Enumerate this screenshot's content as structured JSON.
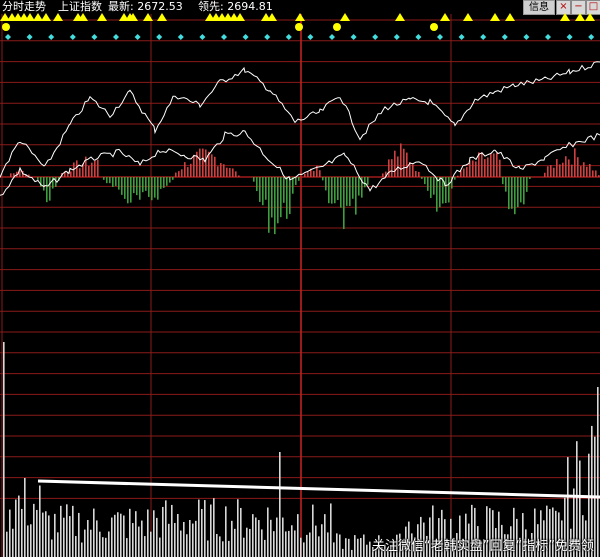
{
  "header": {
    "title": "分时走势",
    "index_name": "上证指数",
    "latest": "最新: 2672.53",
    "leading": "领先: 2694.81",
    "info_button": "信息",
    "close_glyph": "×",
    "minimize_glyph": "−",
    "restore_glyph": "□"
  },
  "colors": {
    "background": "#000000",
    "grid": "#8b1a1a",
    "grid_major": "#c02020",
    "price_line": "#ffffff",
    "up_bar": "#d04040",
    "down_bar": "#3f9e3f",
    "volume_bar": "#d8d8d8",
    "signal_triangle": "#ffff00",
    "signal_diamond": "#44dddd",
    "volume_avg_line": "#ffffff"
  },
  "watermark": "关注微信“老韩实盘”回复“指标”免费领"
}
